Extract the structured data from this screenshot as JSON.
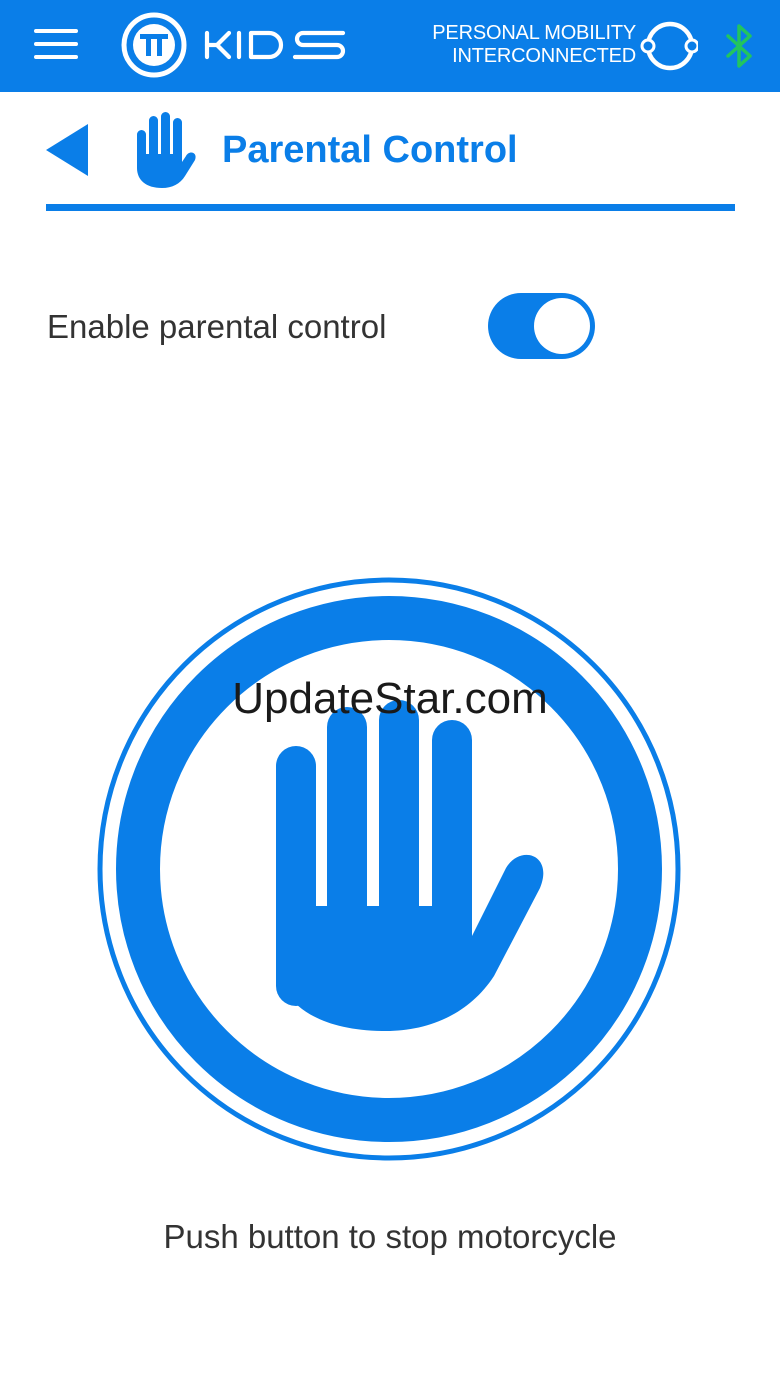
{
  "app": {
    "logo_text": "KIDS",
    "tagline_line1": "PERSONAL MOBILITY",
    "tagline_line2": "INTERCONNECTED",
    "menu_icon": "hamburger-menu-icon",
    "logo_icon": "tt-logo-icon",
    "status_icon": "ring-connector-icon",
    "bluetooth_icon": "bluetooth-icon"
  },
  "header": {
    "title": "Parental Control",
    "back_icon": "back-arrow-icon",
    "title_icon": "hand-icon"
  },
  "settings": {
    "enable_label": "Enable parental control",
    "enabled": true
  },
  "stop": {
    "icon": "stop-hand-icon",
    "caption": "Push button to stop motorcycle"
  },
  "watermark": "UpdateStar.com",
  "colors": {
    "brand_blue": "#0a7ee8",
    "bluetooth_green": "#22c55e",
    "text_gray": "#333333",
    "background": "#ffffff"
  }
}
